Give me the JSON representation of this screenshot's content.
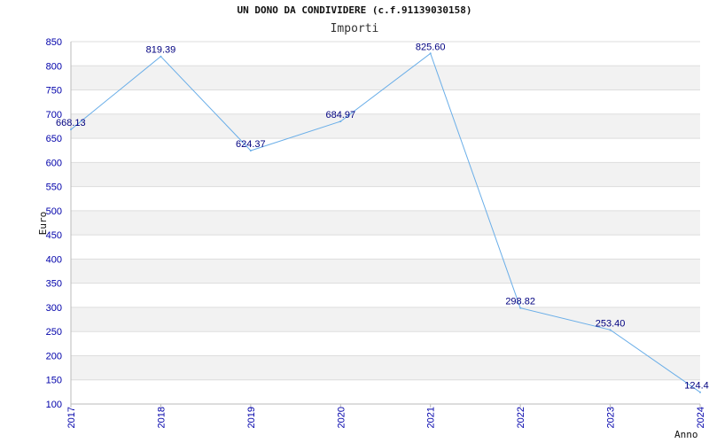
{
  "chart_data": {
    "type": "line",
    "title": "UN DONO DA CONDIVIDERE (c.f.91139030158)",
    "subtitle": "Importi",
    "xlabel": "Anno",
    "ylabel": "Euro",
    "x": [
      "2017",
      "2018",
      "2019",
      "2020",
      "2021",
      "2022",
      "2023",
      "2024"
    ],
    "values": [
      668.13,
      819.39,
      624.37,
      684.97,
      825.6,
      298.82,
      253.4,
      124.4
    ],
    "value_labels": [
      "668.13",
      "819.39",
      "624.37",
      "684.97",
      "825.60",
      "298.82",
      "253.40",
      "124.4"
    ],
    "ylim": [
      100,
      850
    ],
    "yticks": [
      100,
      150,
      200,
      250,
      300,
      350,
      400,
      450,
      500,
      550,
      600,
      650,
      700,
      750,
      800,
      850
    ],
    "grid": true,
    "colors": {
      "line": "#6aaee8",
      "band": "#f2f2f2",
      "grid": "#dddddd",
      "axis": "#bbbbbb",
      "tick_text": "#0000aa",
      "data_label": "#000080"
    }
  }
}
